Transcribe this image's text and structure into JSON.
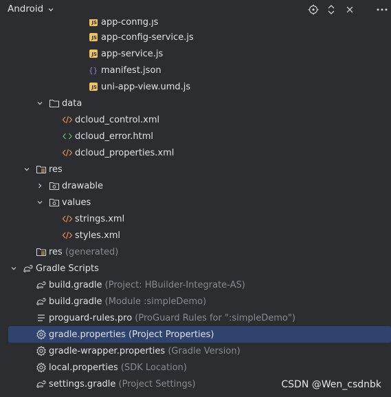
{
  "header": {
    "title": "Android",
    "tools": [
      "locate-icon",
      "expand-collapse-icon",
      "close-icon",
      "more-icon"
    ]
  },
  "tree": {
    "partial_top": "app-config.js",
    "items": [
      {
        "label": "app-config-service.js",
        "hint": "",
        "icon": "js-file-icon"
      },
      {
        "label": "app-service.js",
        "hint": "",
        "icon": "js-file-icon"
      },
      {
        "label": "manifest.json",
        "hint": "",
        "icon": "json-file-icon"
      },
      {
        "label": "uni-app-view.umd.js",
        "hint": "",
        "icon": "js-file-icon"
      },
      {
        "label": "data",
        "hint": "",
        "icon": "folder-icon"
      },
      {
        "label": "dcloud_control.xml",
        "hint": "",
        "icon": "xml-file-icon"
      },
      {
        "label": "dcloud_error.html",
        "hint": "",
        "icon": "html-file-icon"
      },
      {
        "label": "dcloud_properties.xml",
        "hint": "",
        "icon": "xml-file-icon"
      },
      {
        "label": "res",
        "hint": "",
        "icon": "res-folder-icon"
      },
      {
        "label": "drawable",
        "hint": "",
        "icon": "package-folder-icon"
      },
      {
        "label": "values",
        "hint": "",
        "icon": "package-folder-icon"
      },
      {
        "label": "strings.xml",
        "hint": "",
        "icon": "xml-file-icon"
      },
      {
        "label": "styles.xml",
        "hint": "",
        "icon": "xml-file-icon"
      },
      {
        "label": "res",
        "hint": "(generated)",
        "icon": "res-folder-icon"
      },
      {
        "label": "Gradle Scripts",
        "hint": "",
        "icon": "gradle-icon"
      },
      {
        "label": "build.gradle",
        "hint": "(Project: HBuilder-Integrate-AS)",
        "icon": "gradle-icon"
      },
      {
        "label": "build.gradle",
        "hint": "(Module :simpleDemo)",
        "icon": "gradle-icon"
      },
      {
        "label": "proguard-rules.pro",
        "hint": "(ProGuard Rules for \":simpleDemo\")",
        "icon": "text-file-icon"
      },
      {
        "label": "gradle.properties",
        "hint": "(Project Properties)",
        "icon": "settings-file-icon"
      },
      {
        "label": "gradle-wrapper.properties",
        "hint": "(Gradle Version)",
        "icon": "settings-file-icon"
      },
      {
        "label": "local.properties",
        "hint": "(SDK Location)",
        "icon": "settings-file-icon"
      },
      {
        "label": "settings.gradle",
        "hint": "(Project Settings)",
        "icon": "gradle-icon"
      }
    ]
  },
  "watermark": "CSDN @Wen_csdnbk",
  "colors": {
    "background": "#2b2d30",
    "selected": "#2e436e",
    "text": "#dfe1e5",
    "hint": "#868a91",
    "js": "#f2c55c",
    "xml": "#e08855",
    "html": "#5fb865"
  }
}
